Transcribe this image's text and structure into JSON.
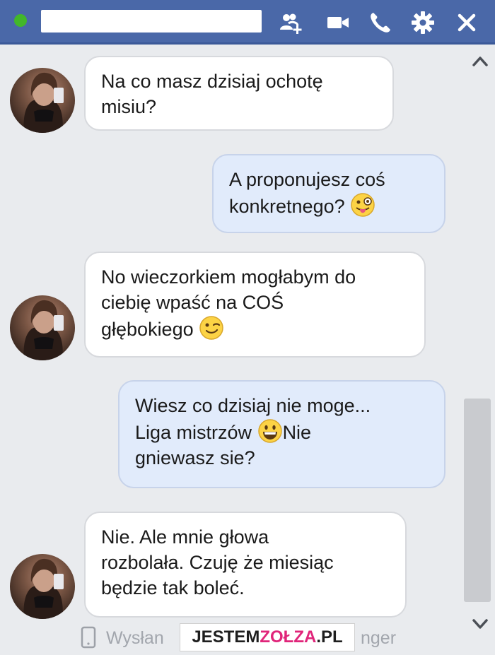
{
  "header": {
    "contact_name": "",
    "status": "online",
    "icons": [
      "add-people-icon",
      "video-call-icon",
      "phone-call-icon",
      "settings-icon",
      "close-icon"
    ]
  },
  "messages": [
    {
      "from": "them",
      "lines": [
        "Na co masz dzisiaj ochotę",
        "misiu?"
      ]
    },
    {
      "from": "me",
      "lines": [
        "A proponujesz coś",
        "konkretnego?"
      ],
      "emoji": "winking-tongue-face"
    },
    {
      "from": "them",
      "lines": [
        "No wieczorkiem mogłabym do",
        "ciebię wpaść na COŚ",
        "głębokiego"
      ],
      "emoji": "winking-face"
    },
    {
      "from": "me",
      "lines": [
        "Wiesz co dzisiaj nie moge...",
        "Liga mistrzów",
        "Nie",
        "gniewasz sie?"
      ],
      "emoji": "grinning-face"
    },
    {
      "from": "them",
      "lines": [
        "Nie. Ale mnie głowa",
        "rozbolała. Czuję że miesiąc",
        "będzie tak boleć."
      ]
    }
  ],
  "footer": {
    "sent_prefix": "Wysłan",
    "sent_suffix": "nger"
  },
  "watermark": {
    "part1": "JESTEM",
    "part2": "ZOŁZA",
    "part3": ".PL"
  },
  "colors": {
    "header": "#4a68a8",
    "online": "#42b72a",
    "incoming_bubble": "#ffffff",
    "outgoing_bubble": "#e1ebfb",
    "background": "#e9ebee"
  }
}
